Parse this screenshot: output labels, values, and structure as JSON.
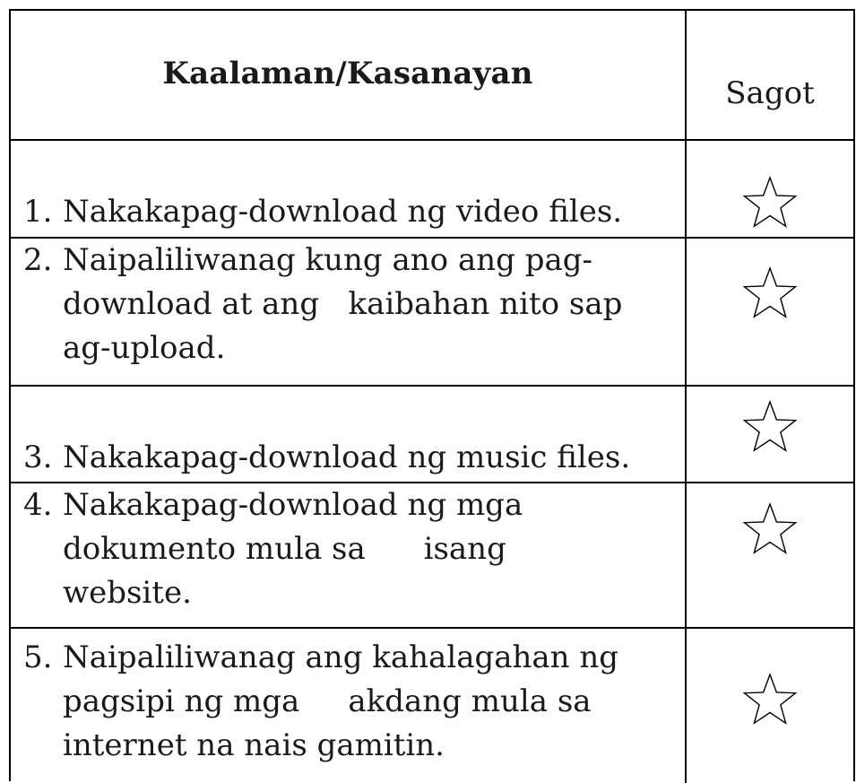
{
  "table": {
    "header": {
      "skill": "Kaalaman/Kasanayan",
      "answer": "Sagot"
    },
    "rows": [
      {
        "number": "1.",
        "text": "Nakakapag-download ng video files.",
        "answer_icon": "star-outline-icon"
      },
      {
        "number": "2.",
        "text": "Naipaliliwanag kung ano ang pag-\ndownload at ang   kaibahan nito sap\nag-upload.",
        "answer_icon": "star-outline-icon"
      },
      {
        "number": "3.",
        "text": "Nakakapag-download ng music files.",
        "answer_icon": "star-outline-icon"
      },
      {
        "number": "4.",
        "text": "Nakakapag-download ng mga\ndokumento mula sa      isang\nwebsite.",
        "answer_icon": "star-outline-icon"
      },
      {
        "number": "5.",
        "text": "Naipaliliwanag ang kahalagahan ng\npagsipi ng mga     akdang mula sa\ninternet na nais gamitin.",
        "answer_icon": "star-outline-icon"
      }
    ]
  },
  "colors": {
    "border": "#000000",
    "text": "#1a1a1a",
    "background": "#ffffff"
  }
}
